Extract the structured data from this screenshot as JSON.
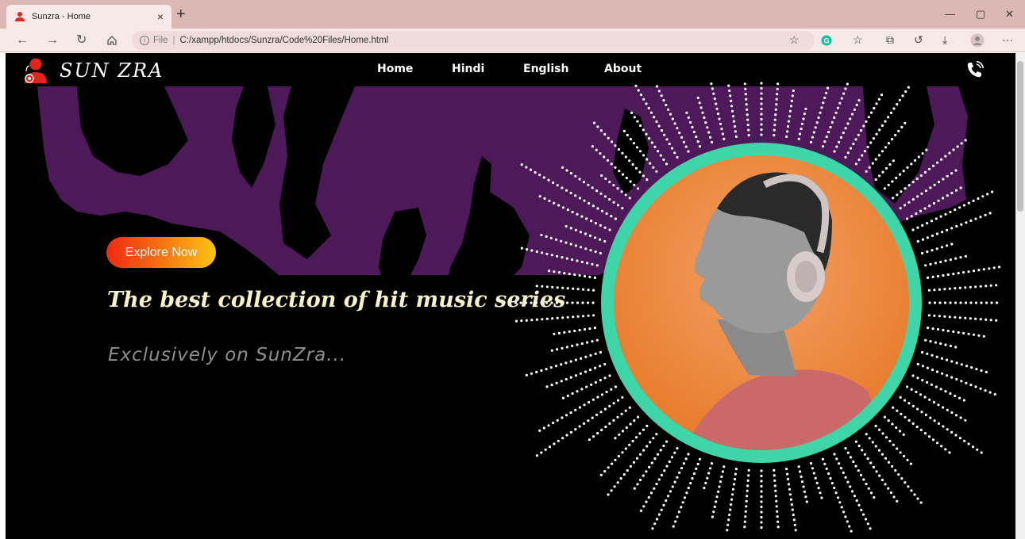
{
  "browser": {
    "tab_title": "Sunzra - Home",
    "tab_close": "×",
    "new_tab": "+",
    "url_scheme": "File",
    "url": "C:/xampp/htdocs/Sunzra/Code%20Files/Home.html",
    "window_minimize": "—",
    "window_restore": "▢",
    "window_close": "✕"
  },
  "site": {
    "logo_text": "SUN ZRA",
    "nav": [
      "Home",
      "Hindi",
      "English",
      "About"
    ],
    "explore_button": "Explore Now",
    "headline": "The best collection of hit music series",
    "subheadline": "Exclusively on SunZra...",
    "colors": {
      "page_bg": "#000000",
      "silhouette": "#4d1958",
      "ring": "#3ed5a9",
      "portrait_bg": "#ee8c4a",
      "headline": "#f7f1c9",
      "subheadline": "#8e8e8e",
      "brand_red": "#e0251b"
    }
  }
}
